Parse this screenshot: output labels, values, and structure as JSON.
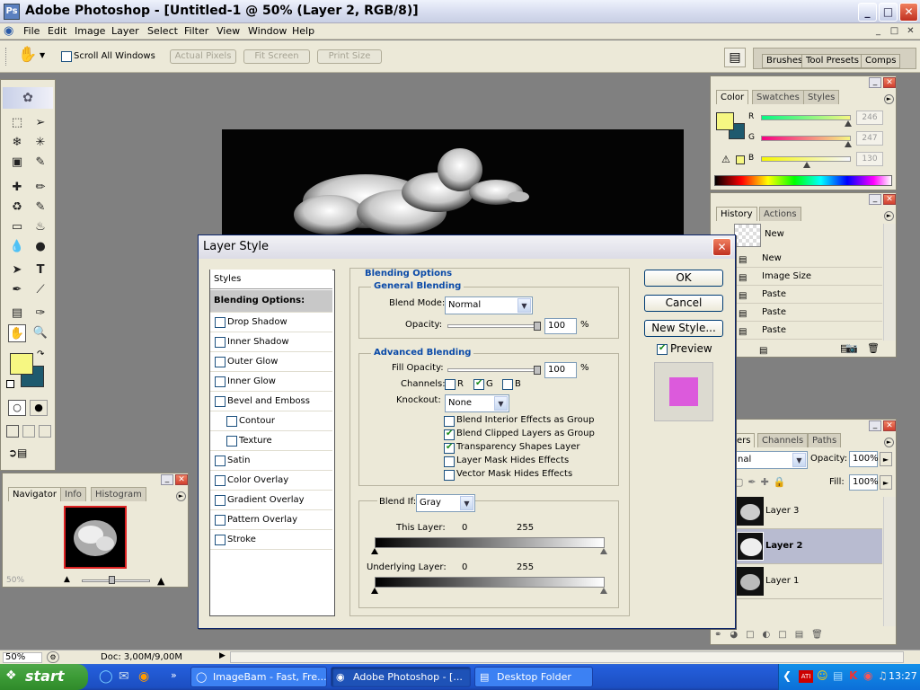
{
  "window": {
    "title": "Adobe Photoshop - [Untitled-1 @ 50% (Layer 2, RGB/8)]",
    "minimize": "_",
    "maximize": "□",
    "close": "✕"
  },
  "menubar": {
    "items": [
      "File",
      "Edit",
      "Image",
      "Layer",
      "Select",
      "Filter",
      "View",
      "Window",
      "Help"
    ],
    "mdi_min": "_",
    "mdi_max": "□",
    "mdi_close": "✕"
  },
  "optionsbar": {
    "scroll_all_windows": "Scroll All Windows",
    "actual_pixels": "Actual Pixels",
    "fit_screen": "Fit Screen",
    "print_size": "Print Size",
    "well_tabs": [
      "Brushes",
      "Tool Presets",
      "Comps"
    ]
  },
  "color_panel": {
    "tabs": [
      "Color",
      "Swatches",
      "Styles"
    ],
    "r_label": "R",
    "g_label": "G",
    "b_label": "B",
    "r_value": "246",
    "g_value": "247",
    "b_value": "130",
    "r_fraction": 0.965,
    "g_fraction": 0.969,
    "b_fraction": 0.51,
    "foreground": "#f6f782",
    "background": "#1e5a6e"
  },
  "history_panel": {
    "tabs": [
      "History",
      "Actions"
    ],
    "snapshot_label": "New",
    "items": [
      "New",
      "Image Size",
      "Paste",
      "Paste",
      "Paste"
    ]
  },
  "navigator_panel": {
    "tabs": [
      "Navigator",
      "Info",
      "Histogram"
    ],
    "zoom": "50%"
  },
  "layers_panel": {
    "tabs": [
      "ers",
      "Channels",
      "Paths"
    ],
    "blend_mode": "nal",
    "opacity_label": "Opacity:",
    "opacity_value": "100%",
    "fill_label": "Fill:",
    "fill_value": "100%",
    "layers": [
      "Layer 3",
      "Layer 2",
      "Layer 1"
    ],
    "selected": "Layer 2"
  },
  "dialog": {
    "title": "Layer Style",
    "close": "✕",
    "styles_header": "Styles",
    "blending_options_item": "Blending Options: Custom",
    "style_items": [
      "Drop Shadow",
      "Inner Shadow",
      "Outer Glow",
      "Inner Glow",
      "Bevel and Emboss",
      "Contour",
      "Texture",
      "Satin",
      "Color Overlay",
      "Gradient Overlay",
      "Pattern Overlay",
      "Stroke"
    ],
    "blending_options_legend": "Blending Options",
    "general_blending_legend": "General Blending",
    "blend_mode_label": "Blend Mode:",
    "blend_mode_value": "Normal",
    "opacity_label": "Opacity:",
    "opacity_value": "100",
    "percent": "%",
    "advanced_blending_legend": "Advanced Blending",
    "fill_opacity_label": "Fill Opacity:",
    "fill_opacity_value": "100",
    "channels_label": "Channels:",
    "channel_r": "R",
    "channel_g": "G",
    "channel_b": "B",
    "knockout_label": "Knockout:",
    "knockout_value": "None",
    "options": [
      {
        "label": "Blend Interior Effects as Group",
        "checked": false
      },
      {
        "label": "Blend Clipped Layers as Group",
        "checked": true
      },
      {
        "label": "Transparency Shapes Layer",
        "checked": true
      },
      {
        "label": "Layer Mask Hides Effects",
        "checked": false
      },
      {
        "label": "Vector Mask Hides Effects",
        "checked": false
      }
    ],
    "blend_if_label": "Blend If:",
    "blend_if_value": "Gray",
    "this_layer_label": "This Layer:",
    "this_layer_min": "0",
    "this_layer_max": "255",
    "underlying_label": "Underlying Layer:",
    "underlying_min": "0",
    "underlying_max": "255",
    "ok": "OK",
    "cancel": "Cancel",
    "new_style": "New Style...",
    "preview": "Preview",
    "preview_swatch": "#dc5adc"
  },
  "statusbar": {
    "zoom": "50%",
    "doc": "Doc: 3,00M/9,00M"
  },
  "taskbar": {
    "start": "start",
    "items": [
      "ImageBam - Fast, Fre...",
      "Adobe Photoshop - [...",
      "Desktop Folder"
    ],
    "clock": "13:27"
  }
}
